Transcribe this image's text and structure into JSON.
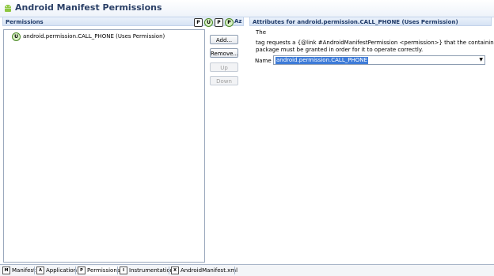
{
  "title": "Android Manifest Permissions",
  "permissions_section": {
    "header": "Permissions",
    "toolbar": [
      "P",
      "U",
      "P",
      "P",
      "Az"
    ],
    "tree_items": [
      {
        "icon": "U",
        "label": "android.permission.CALL_PHONE (Uses Permission)"
      }
    ],
    "buttons": {
      "add": "Add...",
      "remove": "Remove...",
      "up": "Up",
      "down": "Down"
    }
  },
  "attributes_section": {
    "header": "Attributes for android.permission.CALL_PHONE (Uses Permission)",
    "desc_line1": "The",
    "desc_line2": "tag requests a {@link #AndroidManifestPermission <permission>} that the containing",
    "desc_line3": "package must be granted in order for it to operate correctly.",
    "name_label": "Name",
    "name_value": "android.permission.CALL_PHONE"
  },
  "tabs": [
    {
      "icon": "M",
      "label": "Manifest"
    },
    {
      "icon": "A",
      "label": "Application"
    },
    {
      "icon": "P",
      "label": "Permissions"
    },
    {
      "icon": "I",
      "label": "Instrumentation"
    },
    {
      "icon": "X",
      "label": "AndroidManifest.xml"
    }
  ]
}
